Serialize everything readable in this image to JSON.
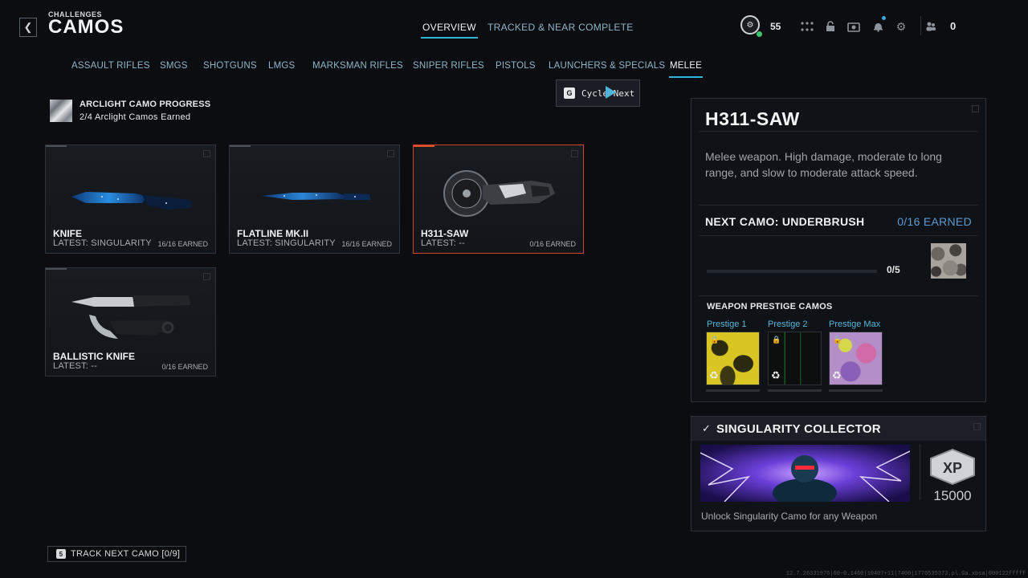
{
  "header": {
    "breadcrumb": "CHALLENGES",
    "title": "CAMOS",
    "tabs": [
      {
        "label": "OVERVIEW",
        "active": true
      },
      {
        "label": "TRACKED & NEAR COMPLETE",
        "active": false
      }
    ],
    "player_level": "55",
    "currency_value": "0",
    "icons": [
      "back-icon",
      "prestige-level-icon",
      "grid-icon",
      "lock-icon",
      "camera-icon",
      "bell-icon",
      "gear-icon",
      "friends-icon"
    ]
  },
  "categories": [
    {
      "label": "ASSAULT RIFLES",
      "active": false
    },
    {
      "label": "SMGS",
      "active": false
    },
    {
      "label": "SHOTGUNS",
      "active": false
    },
    {
      "label": "LMGS",
      "active": false
    },
    {
      "label": "MARKSMAN RIFLES",
      "active": false
    },
    {
      "label": "SNIPER RIFLES",
      "active": false
    },
    {
      "label": "PISTOLS",
      "active": false
    },
    {
      "label": "LAUNCHERS & SPECIALS",
      "active": false
    },
    {
      "label": "MELEE",
      "active": true
    }
  ],
  "cycle_tooltip": {
    "key": "G",
    "label": "Cycle Next"
  },
  "arclight": {
    "title": "ARCLIGHT CAMO PROGRESS",
    "subtitle": "2/4 Arclight Camos Earned"
  },
  "weapons": [
    {
      "name": "KNIFE",
      "latest": "LATEST: SINGULARITY",
      "earned": "16/16 EARNED",
      "selected": false
    },
    {
      "name": "FLATLINE MK.II",
      "latest": "LATEST: SINGULARITY",
      "earned": "16/16 EARNED",
      "selected": false
    },
    {
      "name": "H311-SAW",
      "latest": "LATEST: --",
      "earned": "0/16 EARNED",
      "selected": true
    },
    {
      "name": "BALLISTIC KNIFE",
      "latest": "LATEST: --",
      "earned": "0/16 EARNED",
      "selected": false
    }
  ],
  "detail": {
    "weapon_name": "H311-SAW",
    "description": "Melee weapon. High damage, moderate to long range, and slow to moderate attack speed.",
    "next_camo_label": "NEXT CAMO: UNDERBRUSH",
    "next_camo_earned": "0/16 EARNED",
    "progress_text": "0/5",
    "progress_fraction": 0,
    "prestige_heading": "WEAPON PRESTIGE CAMOS",
    "prestige": [
      {
        "label": "Prestige 1",
        "locked": true
      },
      {
        "label": "Prestige 2",
        "locked": true
      },
      {
        "label": "Prestige Max",
        "locked": true
      }
    ]
  },
  "challenge": {
    "title": "SINGULARITY COLLECTOR",
    "completed": true,
    "xp_label": "XP",
    "xp_value": "15000",
    "description": "Unlock Singularity Camo for any Weapon"
  },
  "footer": {
    "track_key": "5",
    "track_label": "TRACK NEXT CAMO [0/9]",
    "build_string": "12.7.26331976|60-0.1460|10407+11|7400|1776535373.pl.Ga.xbsa|000122fffff"
  },
  "colors": {
    "accent": "#2fb5d8",
    "selected_border": "#d34425",
    "earned_blue": "#5d9bd1",
    "background": "#0b0d10"
  }
}
